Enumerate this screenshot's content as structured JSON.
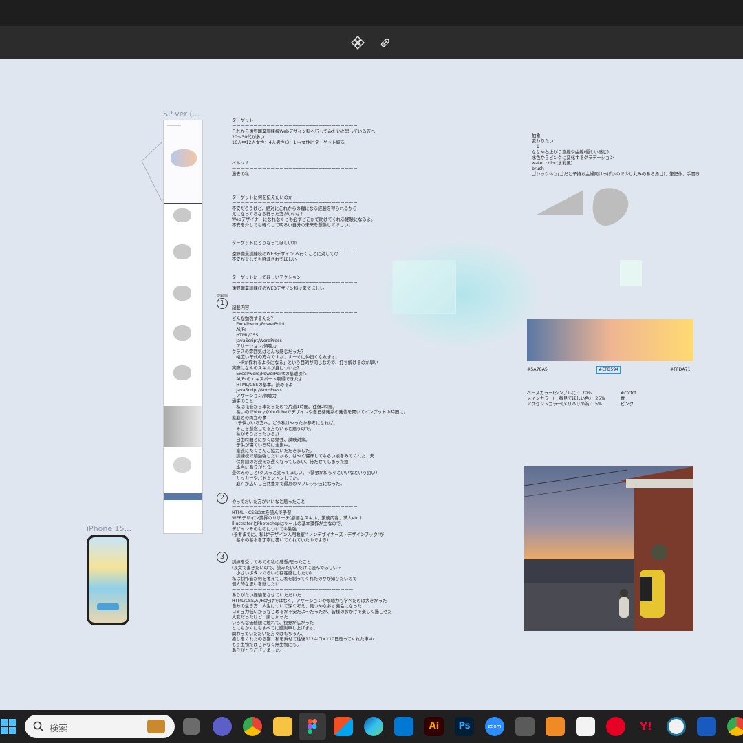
{
  "toolbar": {
    "icons": [
      "component-icon",
      "link-icon"
    ]
  },
  "canvas": {
    "sp_frame_label": "SP ver (...",
    "iphone_frame_label": "iPhone 15...",
    "doc": {
      "target_title": "ターゲット",
      "divider": "ーーーーーーーーーーーーーーーーーーーーーーーーーーーーー",
      "target_lines": [
        "これから遠野職業訓練校Webデザイン科へ行ってみたいと思っている方へ",
        "20～30代が多い",
        "16人中12人女性：4人男性(3：1)→女性にターゲット絞る"
      ],
      "persona_title": "ペルソナ",
      "persona_lines": [
        "過去の私"
      ],
      "convey_title": "ターゲットに何を伝えたいのか",
      "convey_lines": [
        "不安だろうけど、絶対にこれからの糧になる経験を得られるから",
        "気になってるなら行った方がいいよ！",
        "Webデザイナーになれなくとも必ずどこかで助けてくれる経験になるよ。",
        "不安を少しでも軽くして明るい自分の未来を想像してほしい。"
      ],
      "become_title": "ターゲットにどうなってほしいか",
      "become_lines": [
        "遠野職業訓練校のWEBデザイン へ行くことに対しての",
        "不安が少しでも軽減されてほしい"
      ],
      "action_title": "ターゲットにしてほしいアクション",
      "action_lines": [
        "遠野職業訓練校のWEBデザイン科に来てほしい"
      ],
      "s1_tag": "記事内容",
      "s1_num": "1",
      "s1_title": "記載内容",
      "s1_lines": [
        "どんな勉強するんだ？",
        "　Excel/word/PowerPoint",
        "　Ai/Fs",
        "　HTML/CSS",
        "　JavaScript/WordPress",
        "　アサーション/傾聴力",
        "クラスの雰囲気はどんな感じだった？",
        "　幅広い年代の方々ですが、すーぐに仲良くなれます。",
        "　「HPが作れるようになる」という目的が同じなので、打ち解けるのが早い",
        "実際になんのスキルが身についた？",
        "　Excel/word/PowerPointの基礎操作",
        "　Ai/Fsのエキスパート取得できたよ",
        "　HTML/CSSの基本。読めるよ",
        "　JavaScript/WordPress",
        "　アサーション/傾聴力",
        "通学のこと",
        "　私は花巻から車だったので片道1時間。往復2時間。",
        "　長いのでVoicyやYouTubeでデザインや自己啓発系の発信を聞いてインプットの時間に。",
        "家庭との両立の事",
        "　(子供がいる方へ。どう私はやったか参考になれば。",
        "　そこを懸念してる方もいると思うので。",
        "　私がそうだったから。)",
        "　自由時間とにかくは勉強、試験対策。",
        "　子供が寝ている時に全集中。",
        "　家族にたくさんご協力いただきました。",
        "　訓練校で頑勉強したいから、はやく寝床してもらい娘をみてくれた、夫",
        "　保育園のお迎えが遅くなってしまい、待たせてしまった娘",
        "　本当にありがとう。",
        "昼休みのこと(クスっと笑ってほしい。→緊張が和らぐといいなという狙い)",
        "　サッカーやバドミントンしてた。",
        "　庭？が広いし自然豊かで最高のリフレッシュになった。"
      ],
      "s2_num": "2",
      "s2_title": "やっておいた方がいいなと思ったこと",
      "s2_lines": [
        "HTML・CSSの本を読んで予習",
        "WEBデザイン業界のリサーチ(必要なスキル、業務内容、求人etc.)",
        "IllustratorとPhotoshopはツールの基本操作が主なので、",
        "デザインそのものについても勉強",
        "(参考までに、私は\"デザイン入門教室\"\"ノンデザイナーズ・デザインブック\"が",
        "　基本の基本を丁寧に書いてくれていたのでよき)"
      ],
      "s3_num": "3",
      "s3_title": "訓練を受けてみての私の感想/思ったこと",
      "s3_lines": [
        "(長文で書きたいので、読みたい人だけに読んでほしい→",
        "　小さいボタンぐらいの存在感にしたい)",
        "私は制作者が何を考えてこれを創ってくれたのかが知りたいので",
        "個人的な思いを残したい",
        "ーーーーーーーーーーーーーーーーーーーーーーーーーーーー",
        "ありがたい経験をさせていただいた",
        "HTML/CSS/Ai/Fsだけではなく、アサーションや傾聴力も学べたのは大きかった",
        "自分の生き方、人生について深く考え、見つめなおす機会になった",
        "コミュ力低いからなじめるか不安だよ～だったが、皆様のおかげで楽しく過ごせた",
        "大変だったけど、楽しかった",
        "いろんな価値観に触れて、視野が広がった",
        "とにもかくにもすべてに感謝申し上げます。",
        "関わっていただいた方々はもちろん、",
        "癒しをくれたのら猫、私を乗せて往復112キロ×110日走ってくれた車etc",
        "もう生物だけじゃなく無生物にも。",
        "ありがとうございました。"
      ]
    },
    "notes": {
      "lines": [
        "抽象",
        "変わりたい",
        "　↓",
        "ななめ右上がり直線や曲線(優しい感じ)",
        "水色からピンクに変化するグラデーション",
        "water color(水彩風)",
        "brush",
        "ゴシック体(丸ゴだと子持ち主婦向けっぽいので少し丸みのある角ゴ)、筆記体、手書き"
      ]
    },
    "gradient": {
      "stops": [
        "#5A78A5",
        "#EFB594",
        "#FFDA71"
      ],
      "labels": [
        "#5A78A5",
        "#EFB594",
        "#FFDA71"
      ]
    },
    "legend": {
      "rows": [
        {
          "label": "ベースカラー(シンプルに)：70%",
          "value": "#cfcfcf"
        },
        {
          "label": "メインカラー(一番見てほしい色)：25%",
          "value": "青"
        },
        {
          "label": "アクセントカラー(メリハリの為)：5%",
          "value": "ピンク"
        }
      ]
    }
  },
  "taskbar": {
    "search_placeholder": "検索",
    "apps": [
      "windows-start-icon",
      "task-view-icon",
      "teams-icon",
      "chrome-icon",
      "file-explorer-icon",
      "figma-icon",
      "store-icon",
      "edge-icon",
      "mail-icon",
      "illustrator-icon",
      "photoshop-icon",
      "zoom-icon",
      "calculator-icon",
      "app-icon",
      "notepad-icon",
      "pinterest-icon",
      "yahoo-icon",
      "wordpress-icon",
      "word-icon",
      "chrome-icon"
    ],
    "labels": {
      "ai": "Ai",
      "ps": "Ps",
      "zoom": "zoom",
      "yahoo": "Y!"
    }
  },
  "colors": {
    "canvas_bg": "#e0e6ef",
    "toolbar_bg": "#2c2c2c",
    "titlebar_bg": "#1e1e1e",
    "taskbar_bg": "#202020",
    "selection": "#0d99ff"
  }
}
